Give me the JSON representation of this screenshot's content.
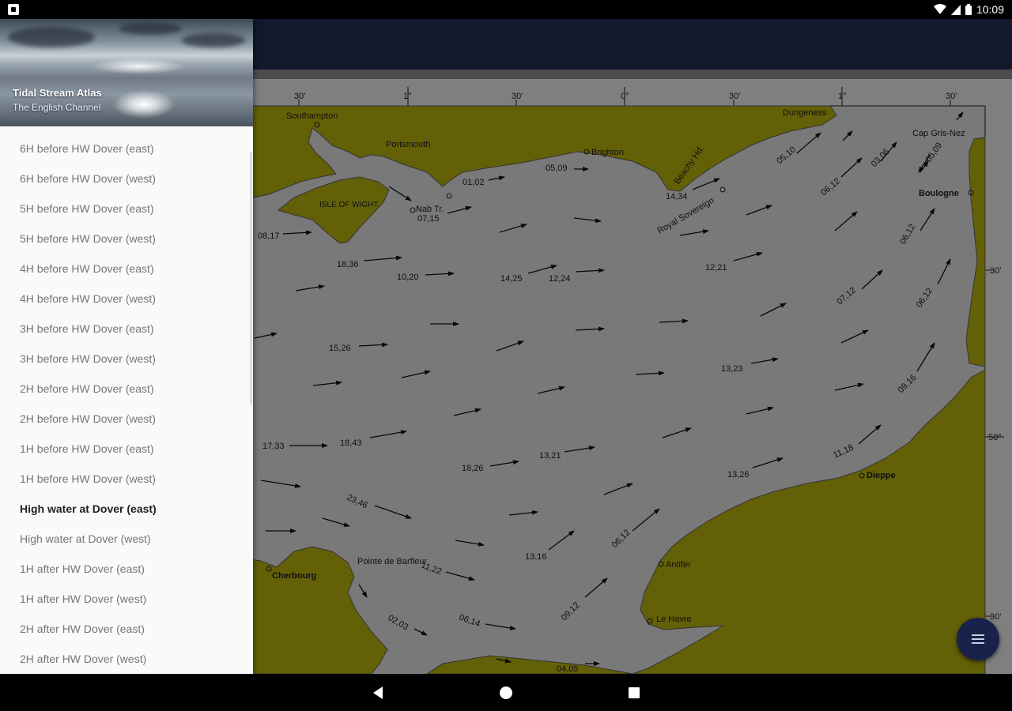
{
  "status_bar": {
    "time": "10:09"
  },
  "drawer": {
    "title": "Tidal Stream Atlas",
    "subtitle": "The English Channel",
    "items": [
      {
        "label": "6H before HW Dover (east)"
      },
      {
        "label": "6H before HW Dover (west)"
      },
      {
        "label": "5H before HW Dover (east)"
      },
      {
        "label": "5H before HW Dover (west)"
      },
      {
        "label": "4H before HW Dover (east)"
      },
      {
        "label": "4H before HW Dover (west)"
      },
      {
        "label": "3H before HW Dover (east)"
      },
      {
        "label": "3H before HW Dover (west)"
      },
      {
        "label": "2H before HW Dover (east)"
      },
      {
        "label": "2H before HW Dover (west)"
      },
      {
        "label": "1H before HW Dover (east)"
      },
      {
        "label": "1H before HW Dover (west)"
      },
      {
        "label": "High water at Dover (east)",
        "selected": true
      },
      {
        "label": "High water at Dover (west)"
      },
      {
        "label": "1H after HW Dover (east)"
      },
      {
        "label": "1H after HW Dover (west)"
      },
      {
        "label": "2H after HW Dover (east)"
      },
      {
        "label": "2H after HW Dover (west)"
      }
    ]
  },
  "map": {
    "top_ticks": [
      "30'",
      "1°",
      "30'",
      "0°",
      "30'",
      "1°",
      "30'"
    ],
    "right_ticks": [
      "30'",
      "50°",
      "30'"
    ],
    "places": [
      "Southampton",
      "Portsmouth",
      "Brighton",
      "Dungeness",
      "Cap Gris-Nez",
      "Boulogne",
      "ISLE OF WIGHT",
      "Nab Tr.",
      "Beachy Hd.",
      "Royal Sovereign",
      "Dieppe",
      "Antifer",
      "Le Havre",
      "Cherbourg",
      "Pointe de Barfleur"
    ],
    "rates": [
      "01,02",
      "05,09",
      "07,15",
      "08,17",
      "18,36",
      "10,20",
      "14,25",
      "12,24",
      "14,34",
      "05,10",
      "06,12",
      "03,06",
      "05,09",
      "12,21",
      "06,12",
      "07,12",
      "06,12",
      "15,26",
      "13,23",
      "09,16",
      "17,33",
      "18,43",
      "18,26",
      "13,21",
      "13,26",
      "11,18",
      "23,46",
      "11,22",
      "13,16",
      "06,12",
      "09,12",
      "06,14",
      "02,03",
      "04,05"
    ]
  },
  "colors": {
    "land": "#c8c010",
    "sea": "#f2f2f2",
    "appbar": "#27315a",
    "fab": "#18224a"
  },
  "icons": {
    "fab": "menu-icon",
    "nav": [
      "back-icon",
      "home-icon",
      "recents-icon"
    ]
  }
}
